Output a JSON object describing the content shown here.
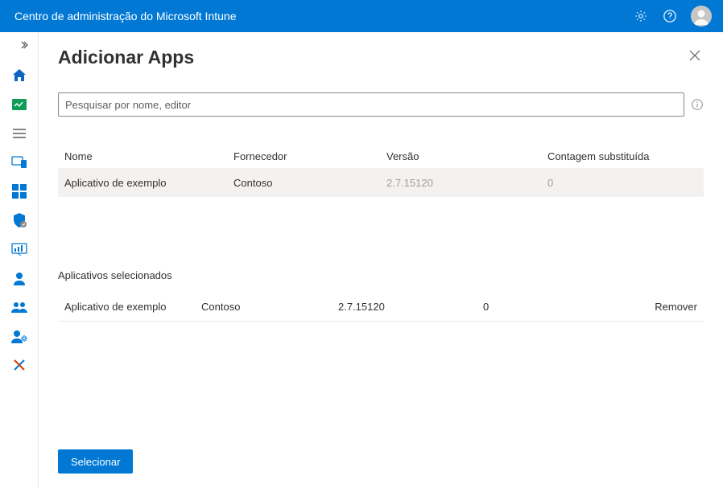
{
  "topbar": {
    "title": "Centro de administração do Microsoft Intune"
  },
  "page": {
    "title": "Adicionar Apps",
    "searchPlaceholder": "Pesquisar por nome, editor",
    "selectButton": "Selecionar"
  },
  "searchTable": {
    "headers": {
      "name": "Nome",
      "vendor": "Fornecedor",
      "version": "Versão",
      "supersededCount": "Contagem substituída"
    },
    "rows": [
      {
        "name": "Aplicativo de exemplo",
        "vendor": "Contoso",
        "version": "2.7.15120",
        "supersededCount": "0"
      }
    ]
  },
  "selected": {
    "title": "Aplicativos selecionados",
    "removeLabel": "Remover",
    "rows": [
      {
        "name": "Aplicativo de exemplo",
        "vendor": "Contoso",
        "version": "2.7.15120",
        "supersededCount": "0"
      }
    ]
  }
}
